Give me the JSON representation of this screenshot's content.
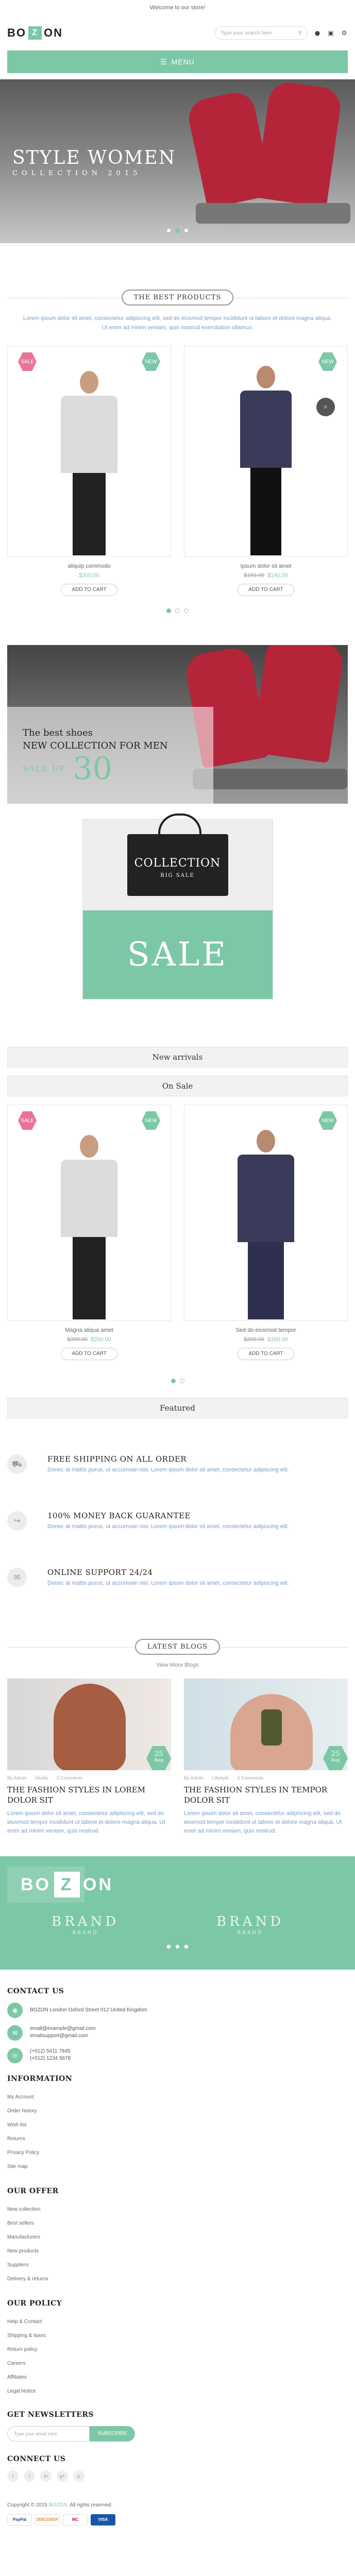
{
  "topbar": {
    "welcome": "Welcome to our store!"
  },
  "header": {
    "logo_left": "BO",
    "logo_mid": "Z",
    "logo_right": "ON",
    "search_placeholder": "Type your search here"
  },
  "menu": {
    "label": "MENU"
  },
  "hero": {
    "title": "STYLE WOMEN",
    "subtitle": "COLLECTION 2015"
  },
  "best_products": {
    "title": "THE BEST PRODUCTS",
    "desc1": "Lorem ipsum dolor sit amet, consectetur adipiscing elit, sed do eiusmod tempor incididunt ut labore et dolore magna aliqua.",
    "desc2": "Ut enim ad minim veniam, quis nostrud exercitation ullamco.",
    "items": [
      {
        "name": "aliquip commodo",
        "price": "$300.00",
        "old": "",
        "badge_l": "SALE",
        "badge_r": "NEW",
        "button": "ADD TO CART"
      },
      {
        "name": "Ipsum dolor sit amet",
        "price": "$140.00",
        "old": "$160.00",
        "badge_l": "",
        "badge_r": "NEW",
        "button": "ADD TO CART"
      }
    ]
  },
  "banner2": {
    "line1": "The best shoes",
    "line2": "NEW COLLECTION FOR MEN",
    "saleup": "SALE UP",
    "pct": "30"
  },
  "sale_box": {
    "bag1": "COLLECTION",
    "bag2": "BIG SALE",
    "sale": "SALE"
  },
  "bars": {
    "new": "New arrivals",
    "onsale": "On Sale",
    "featured": "Featured"
  },
  "onsale_items": [
    {
      "name": "Magna aliqua amet",
      "price": "$200.00",
      "old": "$300.00",
      "badge_l": "SALE",
      "badge_r": "NEW",
      "button": "ADD TO CART"
    },
    {
      "name": "Sed do eiusmod tempor",
      "price": "$180.00",
      "old": "$200.00",
      "badge_l": "",
      "badge_r": "NEW",
      "button": "ADD TO CART"
    }
  ],
  "features": [
    {
      "icon": "truck-icon",
      "glyph": "⛟",
      "title": "FREE SHIPPING ON ALL ORDER",
      "text": "Donec at mattis purus, ut accumsan nisi. Lorem ipsum dolor sit amet, consectetur adipiscing elit."
    },
    {
      "icon": "share-icon",
      "glyph": "↪",
      "title": "100% MONEY BACK GUARANTEE",
      "text": "Donec at mattis purus, ut accumsan nisi. Lorem ipsum dolor sit amet, consectetur adipiscing elit."
    },
    {
      "icon": "chat-icon",
      "glyph": "✉",
      "title": "ONLINE SUPPORT 24/24",
      "text": "Donec at mattis purus, ut accumsan nisi. Lorem ipsum dolor sit amet, consectetur adipiscing elit."
    }
  ],
  "blogs": {
    "title": "LATEST BLOGS",
    "viewmore": "View More Blogs",
    "items": [
      {
        "day": "25",
        "mon": "Aug",
        "author": "By Admin",
        "tag": "Studio",
        "comments": "3 Comments",
        "title": "THE FASHION STYLES IN LOREM DOLOR SIT",
        "text": "Lorem ipsum dolor sit amet, consectetur adipiscing elit, sed do eiusmod tempor incididunt ut labore et dolore magna aliqua. Ut enim ad minim veniam, quis nostrud."
      },
      {
        "day": "25",
        "mon": "Aug",
        "author": "By Admin",
        "tag": "Lifestyle",
        "comments": "3 Comments",
        "title": "THE FASHION STYLES IN TEMPOR DOLOR SIT",
        "text": "Lorem ipsum dolor sit amet, consectetur adipiscing elit, sed do eiusmod tempor incididunt ut labore et dolore magna aliqua. Ut enim ad minim veniam, quis nostrud."
      }
    ]
  },
  "brands": {
    "logo_l": "BO",
    "logo_z": "Z",
    "logo_r": "ON",
    "brand": "BRAND",
    "sub": "BRAND"
  },
  "footer": {
    "contact_title": "CONTACT US",
    "address": "BOZON London Oxford Street 012 United Kingdom",
    "emails": [
      "email@example@gmail.com",
      "emailsupport@gmail.com"
    ],
    "phones": [
      "(+012) 5411 7845",
      "(+012) 1234 5678"
    ],
    "info_title": "INFORMATION",
    "info_items": [
      "My Account",
      "Order history",
      "Wish list",
      "Returns",
      "Privacy Policy",
      "Site map"
    ],
    "offer_title": "OUR OFFER",
    "offer_items": [
      "New collection",
      "Best sellers",
      "Manufacturers",
      "New products",
      "Suppliers",
      "Delivery & returns"
    ],
    "policy_title": "OUR POLICY",
    "policy_items": [
      "Help & Contact",
      "Shipping & taxes",
      "Return policy",
      "Careers",
      "Affiliates",
      "Legal Notice"
    ],
    "newsletter_title": "GET NEWSLETTERS",
    "newsletter_placeholder": "Type your email here",
    "subscribe": "SUBSCRIBE",
    "connect_title": "CONNECT US",
    "social": [
      "f",
      "t",
      "in",
      "g+",
      "p"
    ],
    "copy_pre": "Copyright © 2015",
    "copy_brand": "BOZON",
    "copy_post": ". All rights reserved.",
    "payments": [
      "PayPal",
      "DISCOVER",
      "MC",
      "VISA"
    ]
  }
}
